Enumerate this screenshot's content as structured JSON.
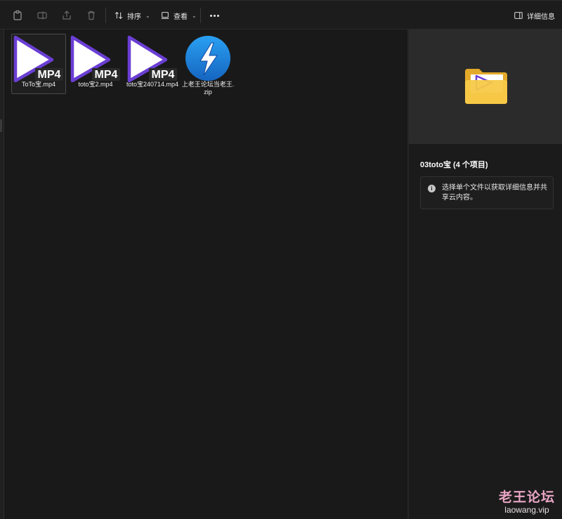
{
  "toolbar": {
    "sort_label": "排序",
    "view_label": "查看",
    "details_label": "详细信息"
  },
  "files": [
    {
      "name": "ToTo宝.mp4",
      "icon": "mp4-video-icon",
      "badge": "MP4"
    },
    {
      "name": "toto宝2.mp4",
      "icon": "mp4-video-icon",
      "badge": "MP4"
    },
    {
      "name": "toto宝240714.mp4",
      "icon": "mp4-video-icon",
      "badge": "MP4"
    },
    {
      "name": "上老王论坛当老王.zip",
      "icon": "zip-archive-icon",
      "badge": ""
    }
  ],
  "details": {
    "title": "03toto宝 (4 个项目)",
    "info": "选择单个文件以获取详细信息并共享云内容。"
  },
  "watermark": {
    "line1": "老王论坛",
    "line2": "laowang.vip"
  },
  "colors": {
    "background": "#191919",
    "play_icon_purple": "#6b3fd4",
    "zip_icon_blue": "#1e88e5",
    "folder_yellow": "#f7c948"
  }
}
